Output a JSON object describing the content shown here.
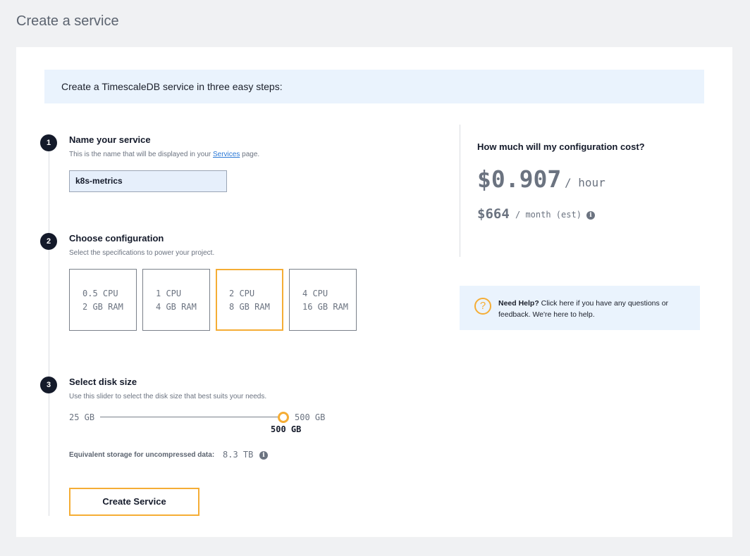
{
  "page_title": "Create a service",
  "banner": "Create a TimescaleDB service in three easy steps:",
  "steps": [
    {
      "number": "1",
      "title": "Name your service",
      "desc_before": "This is the name that will be displayed in your ",
      "desc_link": "Services",
      "desc_after": " page.",
      "input_value": "k8s-metrics"
    },
    {
      "number": "2",
      "title": "Choose configuration",
      "desc": "Select the specifications to power your project.",
      "options": [
        {
          "cpu": "0.5 CPU",
          "ram": "2 GB RAM"
        },
        {
          "cpu": "1 CPU",
          "ram": "4 GB RAM"
        },
        {
          "cpu": "2 CPU",
          "ram": "8 GB RAM"
        },
        {
          "cpu": "4 CPU",
          "ram": "16 GB RAM"
        }
      ],
      "selected_option": "2 CPU"
    },
    {
      "number": "3",
      "title": "Select disk size",
      "desc": "Use this slider to select the disk size that best suits your needs.",
      "min_label": "25 GB",
      "max_label": "500 GB",
      "value_label": "500 GB",
      "slider_fraction": 1.0,
      "equiv_label": "Equivalent storage for uncompressed data:",
      "equiv_value": "8.3 TB"
    }
  ],
  "create_button": "Create Service",
  "cost": {
    "title": "How much will my configuration cost?",
    "hourly": "$0.907",
    "hourly_unit": "/ hour",
    "monthly": "$664",
    "monthly_unit": "/ month (est)"
  },
  "help": {
    "bold": "Need Help?",
    "text": " Click here if you have any questions or feedback. We're here to help."
  },
  "icons": {
    "info": "info-icon",
    "help": "question-icon"
  },
  "colors": {
    "accent": "#f5ad35",
    "banner_bg": "#eaf3fd",
    "step_badge": "#141a2a",
    "link": "#2a78d6"
  }
}
